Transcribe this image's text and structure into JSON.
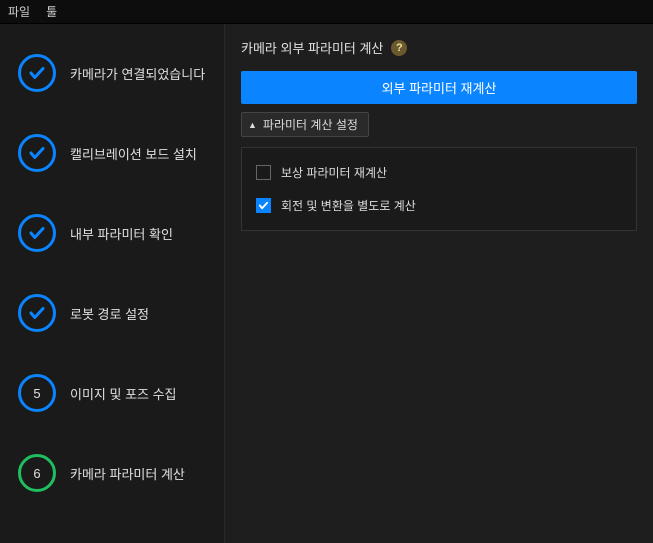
{
  "menu": {
    "file": "파일",
    "tools": "툴"
  },
  "sidebar": {
    "step1": {
      "label": "카메라가 연결되었습니다"
    },
    "step2": {
      "label": "캘리브레이션 보드 설치"
    },
    "step3": {
      "label": "내부 파라미터 확인"
    },
    "step4": {
      "label": "로봇 경로 설정"
    },
    "step5": {
      "number": "5",
      "label": "이미지 및 포즈 수집"
    },
    "step6": {
      "number": "6",
      "label": "카메라 파라미터 계산"
    }
  },
  "main": {
    "title": "카메라 외부 파라미터 계산",
    "help": "?",
    "primary_button": "외부 파라미터 재계산",
    "accordion_label": "파라미터 계산 설정",
    "checkbox1": {
      "label": "보상 파라미터 재계산",
      "checked": false
    },
    "checkbox2": {
      "label": "회전 및 변환을 별도로 계산",
      "checked": true
    }
  }
}
